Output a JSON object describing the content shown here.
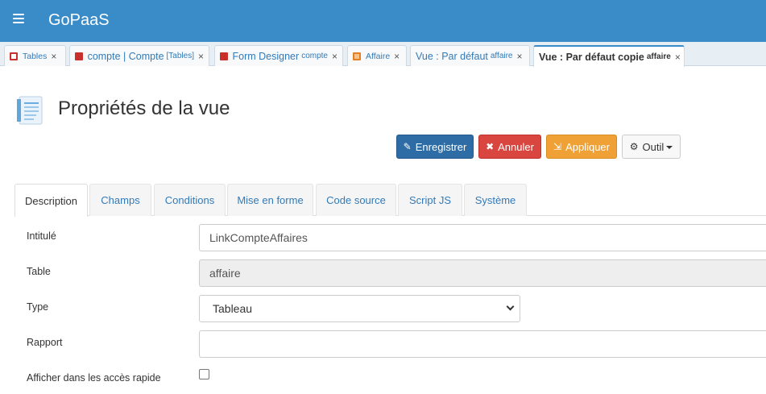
{
  "app": {
    "title": "GoPaaS"
  },
  "tabs": [
    {
      "label": "Tables",
      "sub": "",
      "icon": "table-icon"
    },
    {
      "label": "compte | Compte",
      "sub": "[Tables]",
      "icon": "form-icon"
    },
    {
      "label": "Form Designer",
      "sub": "compte",
      "icon": "form-icon"
    },
    {
      "label": "Affaire",
      "sub": "",
      "icon": "table-orange-icon"
    },
    {
      "label": "Vue : Par défaut",
      "sub": "affaire",
      "icon": ""
    },
    {
      "label": "Vue : Par défaut copie",
      "sub": "affaire",
      "icon": ""
    }
  ],
  "close_glyph": "×",
  "page": {
    "title": "Propriétés de la vue"
  },
  "toolbar": {
    "save": "Enregistrer",
    "cancel": "Annuler",
    "apply": "Appliquer",
    "tool": "Outil"
  },
  "form_tabs": [
    "Description",
    "Champs",
    "Conditions",
    "Mise en forme",
    "Code source",
    "Script JS",
    "Système"
  ],
  "form": {
    "intitule": {
      "label": "Intitulé",
      "value": "LinkCompteAffaires"
    },
    "table": {
      "label": "Table",
      "value": "affaire"
    },
    "type": {
      "label": "Type",
      "value": "Tableau"
    },
    "rapport": {
      "label": "Rapport",
      "value": ""
    },
    "quick_access": {
      "label": "Afficher dans les accès rapide",
      "checked": false
    }
  },
  "colors": {
    "header": "#3a8cc8",
    "save": "#2d6ca5",
    "cancel": "#d9453f",
    "apply": "#f0a135"
  }
}
